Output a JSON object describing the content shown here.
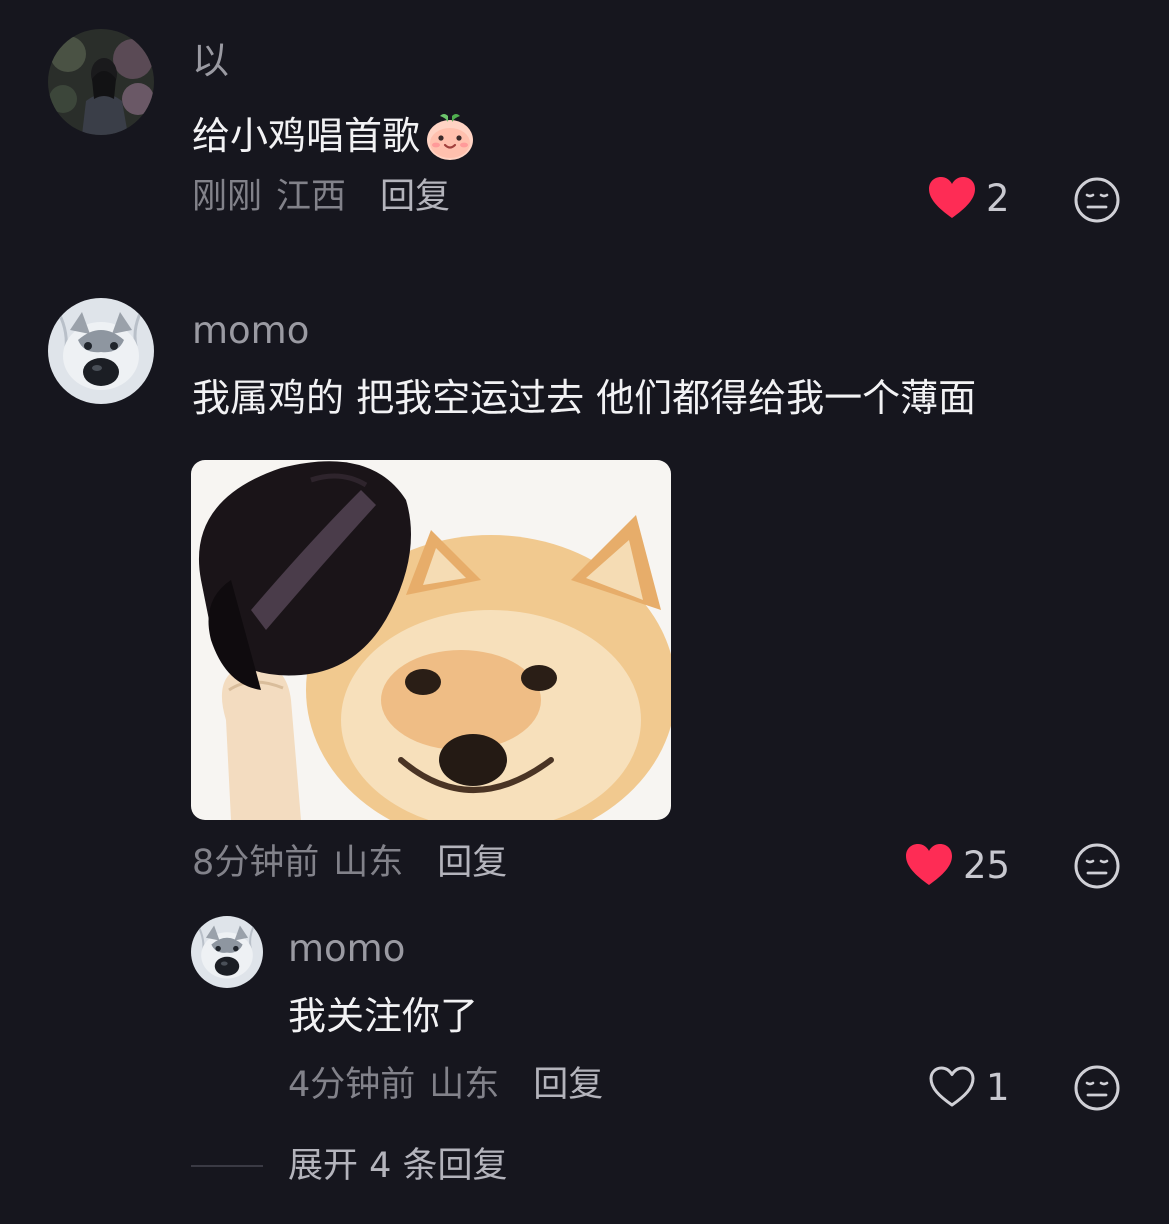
{
  "comments": [
    {
      "username": "以",
      "text": "给小鸡唱首歌",
      "emoji_icon": "smiling-peach-emoji",
      "time": "刚刚",
      "location": "江西",
      "reply_label": "回复",
      "likes": "2",
      "liked": true,
      "avatar_icon": "person-portrait-avatar"
    },
    {
      "username": "momo",
      "text": "我属鸡的 把我空运过去 他们都得给我一个薄面",
      "image_icon": "shiba-dog-tipping-hat-meme",
      "time": "8分钟前",
      "location": "山东",
      "reply_label": "回复",
      "likes": "25",
      "liked": true,
      "avatar_icon": "husky-dog-avatar",
      "replies": [
        {
          "username": "momo",
          "text": "我关注你了",
          "time": "4分钟前",
          "location": "山东",
          "reply_label": "回复",
          "likes": "1",
          "liked": false,
          "avatar_icon": "husky-dog-avatar"
        }
      ],
      "expand_label": "展开 4 条回复"
    }
  ],
  "colors": {
    "background": "#16161e",
    "like_active": "#fe2c55",
    "text_primary": "#f2f2f4",
    "text_secondary": "#82828a"
  }
}
